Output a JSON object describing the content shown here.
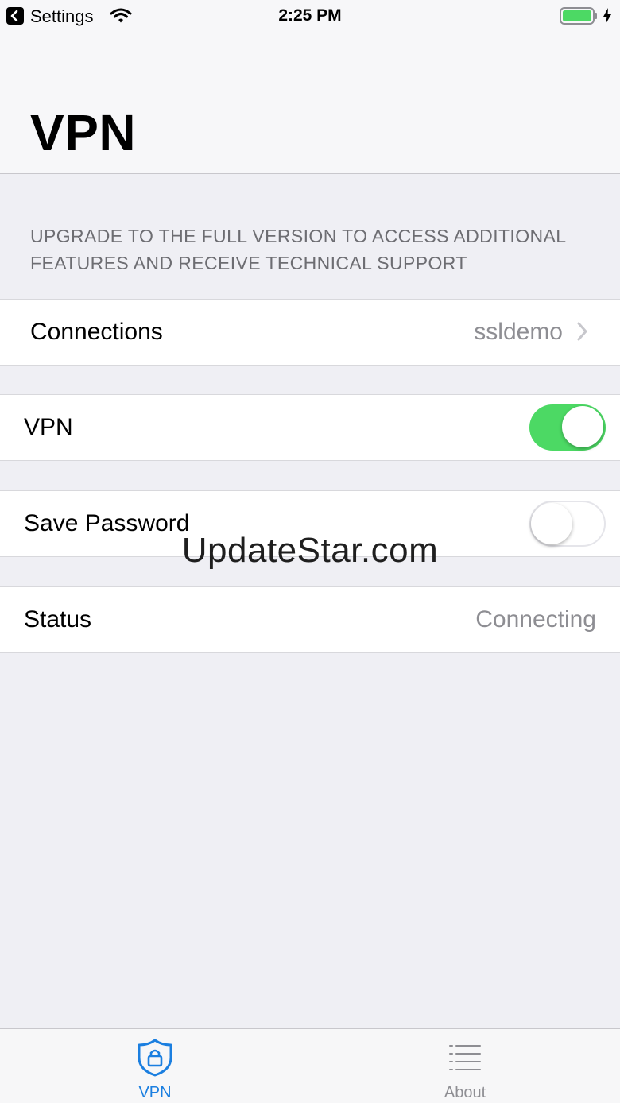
{
  "status_bar": {
    "back_label": "Settings",
    "time": "2:25 PM"
  },
  "header": {
    "title": "VPN"
  },
  "upgrade_note": "UPGRADE TO THE FULL VERSION TO ACCESS ADDITIONAL FEATURES AND RECEIVE TECHNICAL SUPPORT",
  "rows": {
    "connections": {
      "label": "Connections",
      "value": "ssldemo"
    },
    "vpn": {
      "label": "VPN",
      "enabled": true
    },
    "save_password": {
      "label": "Save Password",
      "enabled": false
    },
    "status": {
      "label": "Status",
      "value": "Connecting"
    }
  },
  "watermark": "UpdateStar.com",
  "tab_bar": {
    "tabs": [
      {
        "label": "VPN",
        "icon": "shield-lock-icon",
        "selected": true
      },
      {
        "label": "About",
        "icon": "list-icon",
        "selected": false
      }
    ]
  },
  "colors": {
    "accent": "#1b7fe0",
    "switch_on": "#4cd964",
    "secondary_text": "#8e8e93",
    "background": "#efeff4"
  }
}
